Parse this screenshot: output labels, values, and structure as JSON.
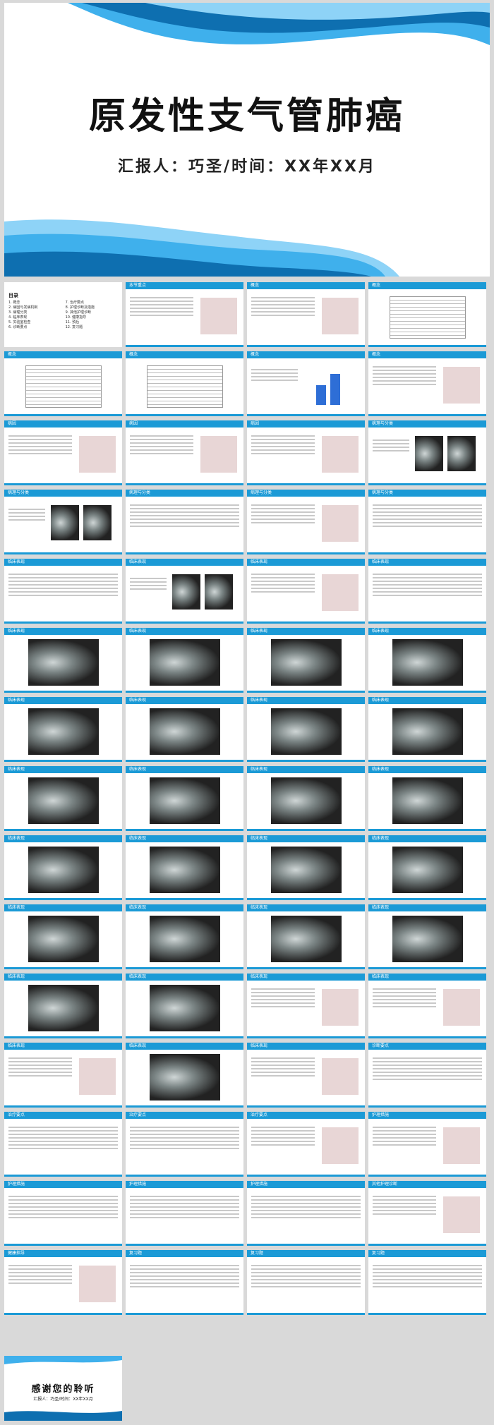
{
  "cover": {
    "title": "原发性支气管肺癌",
    "subtitle": "汇报人：巧圣/时间：XX年XX月"
  },
  "toc_slide": {
    "heading": "目录",
    "items": [
      "1. 概念",
      "2. 病因与发病机制",
      "3. 病理分类",
      "4. 临床表现",
      "5. 实验室检查",
      "6. 诊断要点",
      "7. 治疗要点",
      "8. 护理诊断及措施",
      "9. 其他护理诊断",
      "10. 健康指导",
      "11. 预后",
      "12. 复习题"
    ]
  },
  "slides": [
    {
      "title": "本节重点",
      "kind": "text-img"
    },
    {
      "title": "概念",
      "kind": "text-img"
    },
    {
      "title": "概念",
      "kind": "table"
    },
    {
      "title": "概念",
      "kind": "table"
    },
    {
      "title": "概念",
      "kind": "table"
    },
    {
      "title": "概念",
      "kind": "chart"
    },
    {
      "title": "概念",
      "kind": "text-img"
    },
    {
      "title": "病因",
      "kind": "text-img"
    },
    {
      "title": "病因",
      "kind": "text-img"
    },
    {
      "title": "病因",
      "kind": "text-img"
    },
    {
      "title": "病理与分类",
      "kind": "xray2"
    },
    {
      "title": "病理与分类",
      "kind": "xray2"
    },
    {
      "title": "病理与分类",
      "kind": "text"
    },
    {
      "title": "病理与分类",
      "kind": "text-img"
    },
    {
      "title": "病理与分类",
      "kind": "text"
    },
    {
      "title": "临床表现",
      "kind": "text"
    },
    {
      "title": "临床表现",
      "kind": "xray2"
    },
    {
      "title": "临床表现",
      "kind": "text-img"
    },
    {
      "title": "临床表现",
      "kind": "text"
    },
    {
      "title": "临床表现",
      "kind": "xray"
    },
    {
      "title": "临床表现",
      "kind": "xray"
    },
    {
      "title": "临床表现",
      "kind": "xray"
    },
    {
      "title": "临床表现",
      "kind": "xray"
    },
    {
      "title": "临床表现",
      "kind": "xray"
    },
    {
      "title": "临床表现",
      "kind": "xray"
    },
    {
      "title": "临床表现",
      "kind": "xray"
    },
    {
      "title": "临床表现",
      "kind": "xray"
    },
    {
      "title": "临床表现",
      "kind": "xray"
    },
    {
      "title": "临床表现",
      "kind": "xray"
    },
    {
      "title": "临床表现",
      "kind": "xray"
    },
    {
      "title": "临床表现",
      "kind": "xray"
    },
    {
      "title": "临床表现",
      "kind": "xray"
    },
    {
      "title": "临床表现",
      "kind": "xray"
    },
    {
      "title": "临床表现",
      "kind": "xray"
    },
    {
      "title": "临床表现",
      "kind": "xray"
    },
    {
      "title": "临床表现",
      "kind": "xray"
    },
    {
      "title": "临床表现",
      "kind": "xray"
    },
    {
      "title": "临床表现",
      "kind": "xray"
    },
    {
      "title": "临床表现",
      "kind": "xray"
    },
    {
      "title": "临床表现",
      "kind": "xray"
    },
    {
      "title": "临床表现",
      "kind": "xray"
    },
    {
      "title": "临床表现",
      "kind": "text-img"
    },
    {
      "title": "临床表现",
      "kind": "text-img"
    },
    {
      "title": "临床表现",
      "kind": "text-img"
    },
    {
      "title": "临床表现",
      "kind": "xray"
    },
    {
      "title": "临床表现",
      "kind": "text-img"
    },
    {
      "title": "诊断要点",
      "kind": "text"
    },
    {
      "title": "治疗要点",
      "kind": "text"
    },
    {
      "title": "治疗要点",
      "kind": "text"
    },
    {
      "title": "治疗要点",
      "kind": "text-img"
    },
    {
      "title": "护理措施",
      "kind": "text-img"
    },
    {
      "title": "护理措施",
      "kind": "text"
    },
    {
      "title": "护理措施",
      "kind": "text"
    },
    {
      "title": "护理措施",
      "kind": "text"
    },
    {
      "title": "其他护理诊断",
      "kind": "text-img"
    },
    {
      "title": "健康指导",
      "kind": "text-img"
    },
    {
      "title": "复习题",
      "kind": "text"
    },
    {
      "title": "复习题",
      "kind": "text"
    },
    {
      "title": "复习题",
      "kind": "text"
    }
  ],
  "thanks": {
    "title": "感谢您的聆听",
    "subtitle": "汇报人：巧圣/时间：XX年XX月"
  },
  "colors": {
    "accent": "#1b9ad6",
    "dark_wave": "#0e6fb0",
    "light_wave": "#3fb0ec"
  }
}
